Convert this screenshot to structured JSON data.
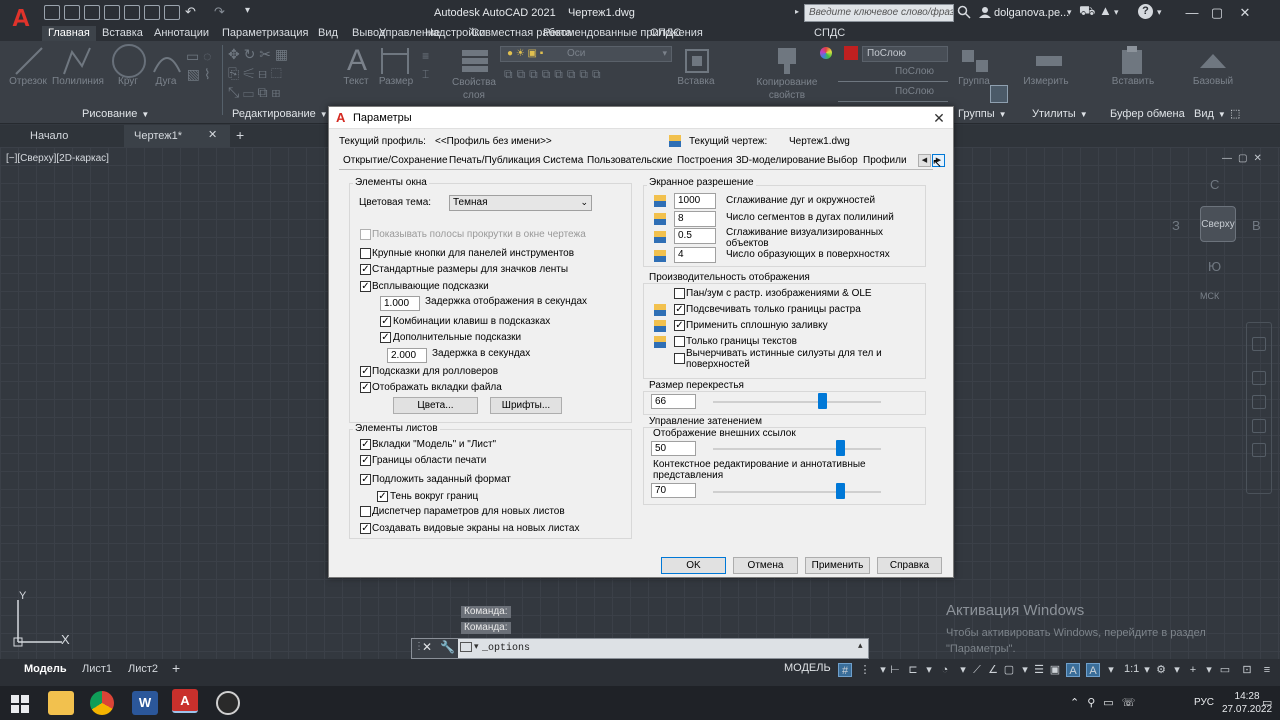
{
  "app": {
    "logo": "A",
    "title": "Autodesk AutoCAD 2021",
    "document": "Чертеж1.dwg",
    "search_placeholder": "Введите ключевое слово/фразу",
    "username": "dolganova.pe..."
  },
  "ribbon_tabs": [
    "Главная",
    "Вставка",
    "Аннотации",
    "Параметризация",
    "Вид",
    "Вывод",
    "Надстройки",
    "Совместная работа",
    "Рекомендованные приложения",
    "СПДС"
  ],
  "ribbon": {
    "draw_tools": [
      "Отрезок",
      "Полилиния",
      "Круг",
      "Дуга"
    ],
    "annot_tools": [
      "Текст",
      "Размер"
    ],
    "layer_tools": [
      "Свойства слоя"
    ],
    "layer_name": "Оси",
    "insert_label": "Вставка",
    "copy_props_label": "Копирование свойств",
    "bylayer": [
      "ПоСлою",
      "ПоСлою",
      "ПоСлою"
    ],
    "group_label": "Группа",
    "measure_label": "Измерить",
    "paste_label": "Вставить",
    "base_label": "Базовый",
    "panels": [
      "Рисование",
      "Редактирование",
      "Группы",
      "Утилиты",
      "Буфер обмена",
      "Вид"
    ]
  },
  "file_tabs": [
    "Начало",
    "Чертеж1*"
  ],
  "viewport_label": "[−][Сверху][2D-каркас]",
  "viewcube": {
    "face": "Сверху",
    "north": "С",
    "west": "З",
    "east": "В",
    "south": "Ю",
    "wcs": "МСК"
  },
  "ucs": {
    "x": "X",
    "y": "Y"
  },
  "dialog": {
    "title": "Параметры",
    "profile_label": "Текущий профиль:",
    "profile_value": "<<Профиль без имени>>",
    "drawing_label": "Текущий чертеж:",
    "drawing_value": "Чертеж1.dwg",
    "tabs": [
      "Открытие/Сохранение",
      "Печать/Публикация",
      "Система",
      "Пользовательские",
      "Построения",
      "3D-моделирование",
      "Выбор",
      "Профили"
    ],
    "window_elements": {
      "title": "Элементы окна",
      "theme_label": "Цветовая тема:",
      "theme_value": "Темная",
      "items": [
        {
          "label": "Показывать полосы прокрутки в окне чертежа",
          "checked": false,
          "enabled": false
        },
        {
          "label": "Крупные кнопки для панелей инструментов",
          "checked": false,
          "enabled": true
        },
        {
          "label": "Стандартные размеры для значков ленты",
          "checked": true,
          "enabled": true
        },
        {
          "label": "Всплывающие подсказки",
          "checked": true,
          "enabled": true
        }
      ],
      "delay_value": "1.000",
      "delay_label": "Задержка отображения в секундах",
      "sub_items": [
        {
          "label": "Комбинации клавиш в подсказках",
          "checked": true
        },
        {
          "label": "Дополнительные подсказки",
          "checked": true
        }
      ],
      "delay2_value": "2.000",
      "delay2_label": "Задержка в секундах",
      "items2": [
        {
          "label": "Подсказки для ролловеров",
          "checked": true
        },
        {
          "label": "Отображать вкладки файла",
          "checked": true
        }
      ],
      "colors_button": "Цвета...",
      "fonts_button": "Шрифты..."
    },
    "layout_elements": {
      "title": "Элементы листов",
      "items": [
        {
          "label": "Вкладки \"Модель\" и \"Лист\"",
          "checked": true
        },
        {
          "label": "Границы области печати",
          "checked": true
        },
        {
          "label": "Подложить заданный формат",
          "checked": true
        },
        {
          "label": "Тень вокруг границ",
          "checked": true
        },
        {
          "label": "Диспетчер параметров для новых листов",
          "checked": false
        },
        {
          "label": "Создавать видовые экраны на новых листах",
          "checked": true
        }
      ]
    },
    "resolution": {
      "title": "Экранное разрешение",
      "items": [
        {
          "value": "1000",
          "label": "Сглаживание дуг и окружностей"
        },
        {
          "value": "8",
          "label": "Число сегментов в дугах полилиний"
        },
        {
          "value": "0.5",
          "label": "Сглаживание визуализированных объектов"
        },
        {
          "value": "4",
          "label": "Число образующих в поверхностях"
        }
      ]
    },
    "performance": {
      "title": "Производительность отображения",
      "items": [
        {
          "label": "Пан/зум с растр. изображениями & OLE",
          "checked": false
        },
        {
          "label": "Подсвечивать только границы растра",
          "checked": true
        },
        {
          "label": "Применить сплошную заливку",
          "checked": true
        },
        {
          "label": "Только границы текстов",
          "checked": false
        },
        {
          "label": "Вычерчивать истинные силуэты для тел и поверхностей",
          "checked": false
        }
      ]
    },
    "crosshair": {
      "title": "Размер перекрестья",
      "value": "66",
      "fraction": 0.66
    },
    "fade": {
      "title": "Управление затенением",
      "xref_label": "Отображение внешних ссылок",
      "xref_value": "50",
      "xref_fraction": 0.8,
      "inplace_label": "Контекстное редактирование и аннотативные представления",
      "inplace_value": "70",
      "inplace_fraction": 0.8
    },
    "buttons": {
      "ok": "OK",
      "cancel": "Отмена",
      "apply": "Применить",
      "help": "Справка"
    }
  },
  "command": {
    "history": [
      "Команда:",
      "Команда:"
    ],
    "input": "_options"
  },
  "activation": {
    "title": "Активация Windows",
    "text": "Чтобы активировать Windows, перейдите в раздел \"Параметры\"."
  },
  "layout_tabs": [
    "Модель",
    "Лист1",
    "Лист2"
  ],
  "status": {
    "model": "МОДЕЛЬ",
    "scale": "1:1"
  },
  "taskbar": {
    "lang": "РУС",
    "time": "14:28",
    "date": "27.07.2022"
  }
}
